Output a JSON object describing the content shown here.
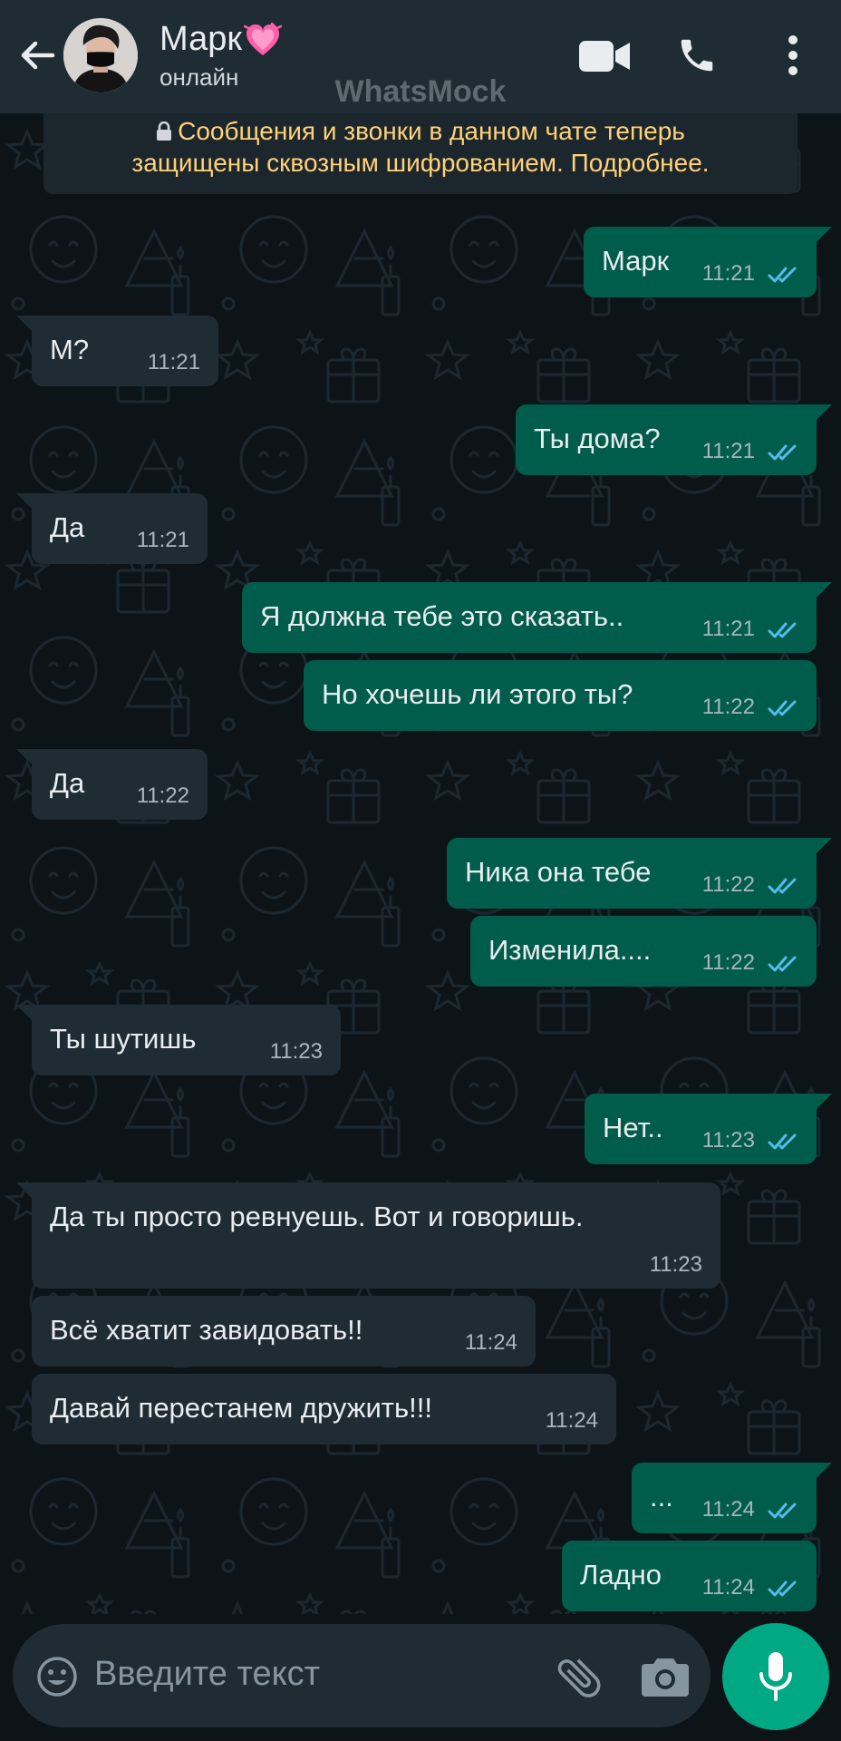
{
  "header": {
    "contact_name": "Марк",
    "contact_status": "онлайн",
    "watermark": "WhatsMock",
    "icons": [
      "back-arrow-icon",
      "heart-icon",
      "video-call-icon",
      "phone-icon",
      "more-vert-icon"
    ]
  },
  "encryption_notice": {
    "line1": "Сообщения и звонки в данном чате теперь",
    "line2": "защищены сквозным шифрованием. Подробнее."
  },
  "messages": [
    {
      "dir": "out",
      "text": "Марк",
      "time": "11:21"
    },
    {
      "dir": "in",
      "text": "М?",
      "time": "11:21"
    },
    {
      "dir": "out",
      "text": "Ты дома?",
      "time": "11:21"
    },
    {
      "dir": "in",
      "text": "Да",
      "time": "11:21"
    },
    {
      "dir": "out",
      "text": "Я должна тебе это сказать..",
      "time": "11:21"
    },
    {
      "dir": "out",
      "text": "Но хочешь ли этого ты?",
      "time": "11:22"
    },
    {
      "dir": "in",
      "text": "Да",
      "time": "11:22"
    },
    {
      "dir": "out",
      "text": "Ника она тебе",
      "time": "11:22"
    },
    {
      "dir": "out",
      "text": "Изменила....",
      "time": "11:22"
    },
    {
      "dir": "in",
      "text": "Ты шутишь",
      "time": "11:23"
    },
    {
      "dir": "out",
      "text": "Нет..",
      "time": "11:23"
    },
    {
      "dir": "in",
      "text": "Да ты просто ревнуешь. Вот и говоришь.",
      "time": "11:23"
    },
    {
      "dir": "in",
      "text": "Всё хватит завидовать!!",
      "time": "11:24"
    },
    {
      "dir": "in",
      "text": "Давай перестанем дружить!!!",
      "time": "11:24"
    },
    {
      "dir": "out",
      "text": "...",
      "time": "11:24"
    },
    {
      "dir": "out",
      "text": "Ладно",
      "time": "11:24"
    }
  ],
  "composer": {
    "placeholder": "Введите текст",
    "icons": [
      "emoji-icon",
      "attach-icon",
      "camera-icon",
      "mic-icon"
    ]
  },
  "colors": {
    "header_bg": "#1f2c34",
    "chat_bg": "#0d1418",
    "outgoing_bubble": "#005c4b",
    "incoming_bubble": "#202c33",
    "read_ticks": "#53bdeb",
    "notice_text": "#ffd279",
    "accent": "#00a884"
  }
}
